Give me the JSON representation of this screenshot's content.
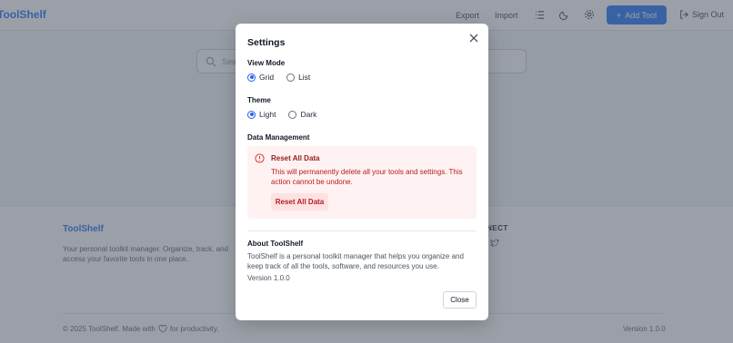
{
  "app": {
    "logo": "ToolShelf",
    "header": {
      "export_label": "Export",
      "import_label": "Import",
      "add_tool_label": "Add Tool",
      "sign_out_label": "Sign Out"
    },
    "search": {
      "placeholder": "Sea"
    },
    "footer": {
      "title": "ToolShelf",
      "description": "Your personal toolkit manager. Organize, track, and access your favorite tools in one place.",
      "connect_label": "NECT",
      "copyright_prefix": "© 2025 ToolShelf. Made with",
      "copyright_suffix": "for productivity.",
      "version": "Version 1.0.0"
    }
  },
  "modal": {
    "title": "Settings",
    "view_mode": {
      "label": "View Mode",
      "options": [
        {
          "label": "Grid",
          "selected": true
        },
        {
          "label": "List",
          "selected": false
        }
      ]
    },
    "theme": {
      "label": "Theme",
      "options": [
        {
          "label": "Light",
          "selected": true
        },
        {
          "label": "Dark",
          "selected": false
        }
      ]
    },
    "data_management": {
      "label": "Data Management",
      "reset_title": "Reset All Data",
      "reset_warning": "This will permanently delete all your tools and settings. This action cannot be undone.",
      "reset_button": "Reset All Data"
    },
    "about": {
      "title": "About ToolShelf",
      "text": "ToolShelf is a personal toolkit manager that helps you organize and keep track of all the tools, software, and resources you use.",
      "version": "Version 1.0.0"
    },
    "close_button": "Close"
  },
  "colors": {
    "accent": "#3b82f6",
    "danger_bg": "#fef2f2",
    "danger_text": "#b91c1c",
    "overlay": "#374151"
  }
}
